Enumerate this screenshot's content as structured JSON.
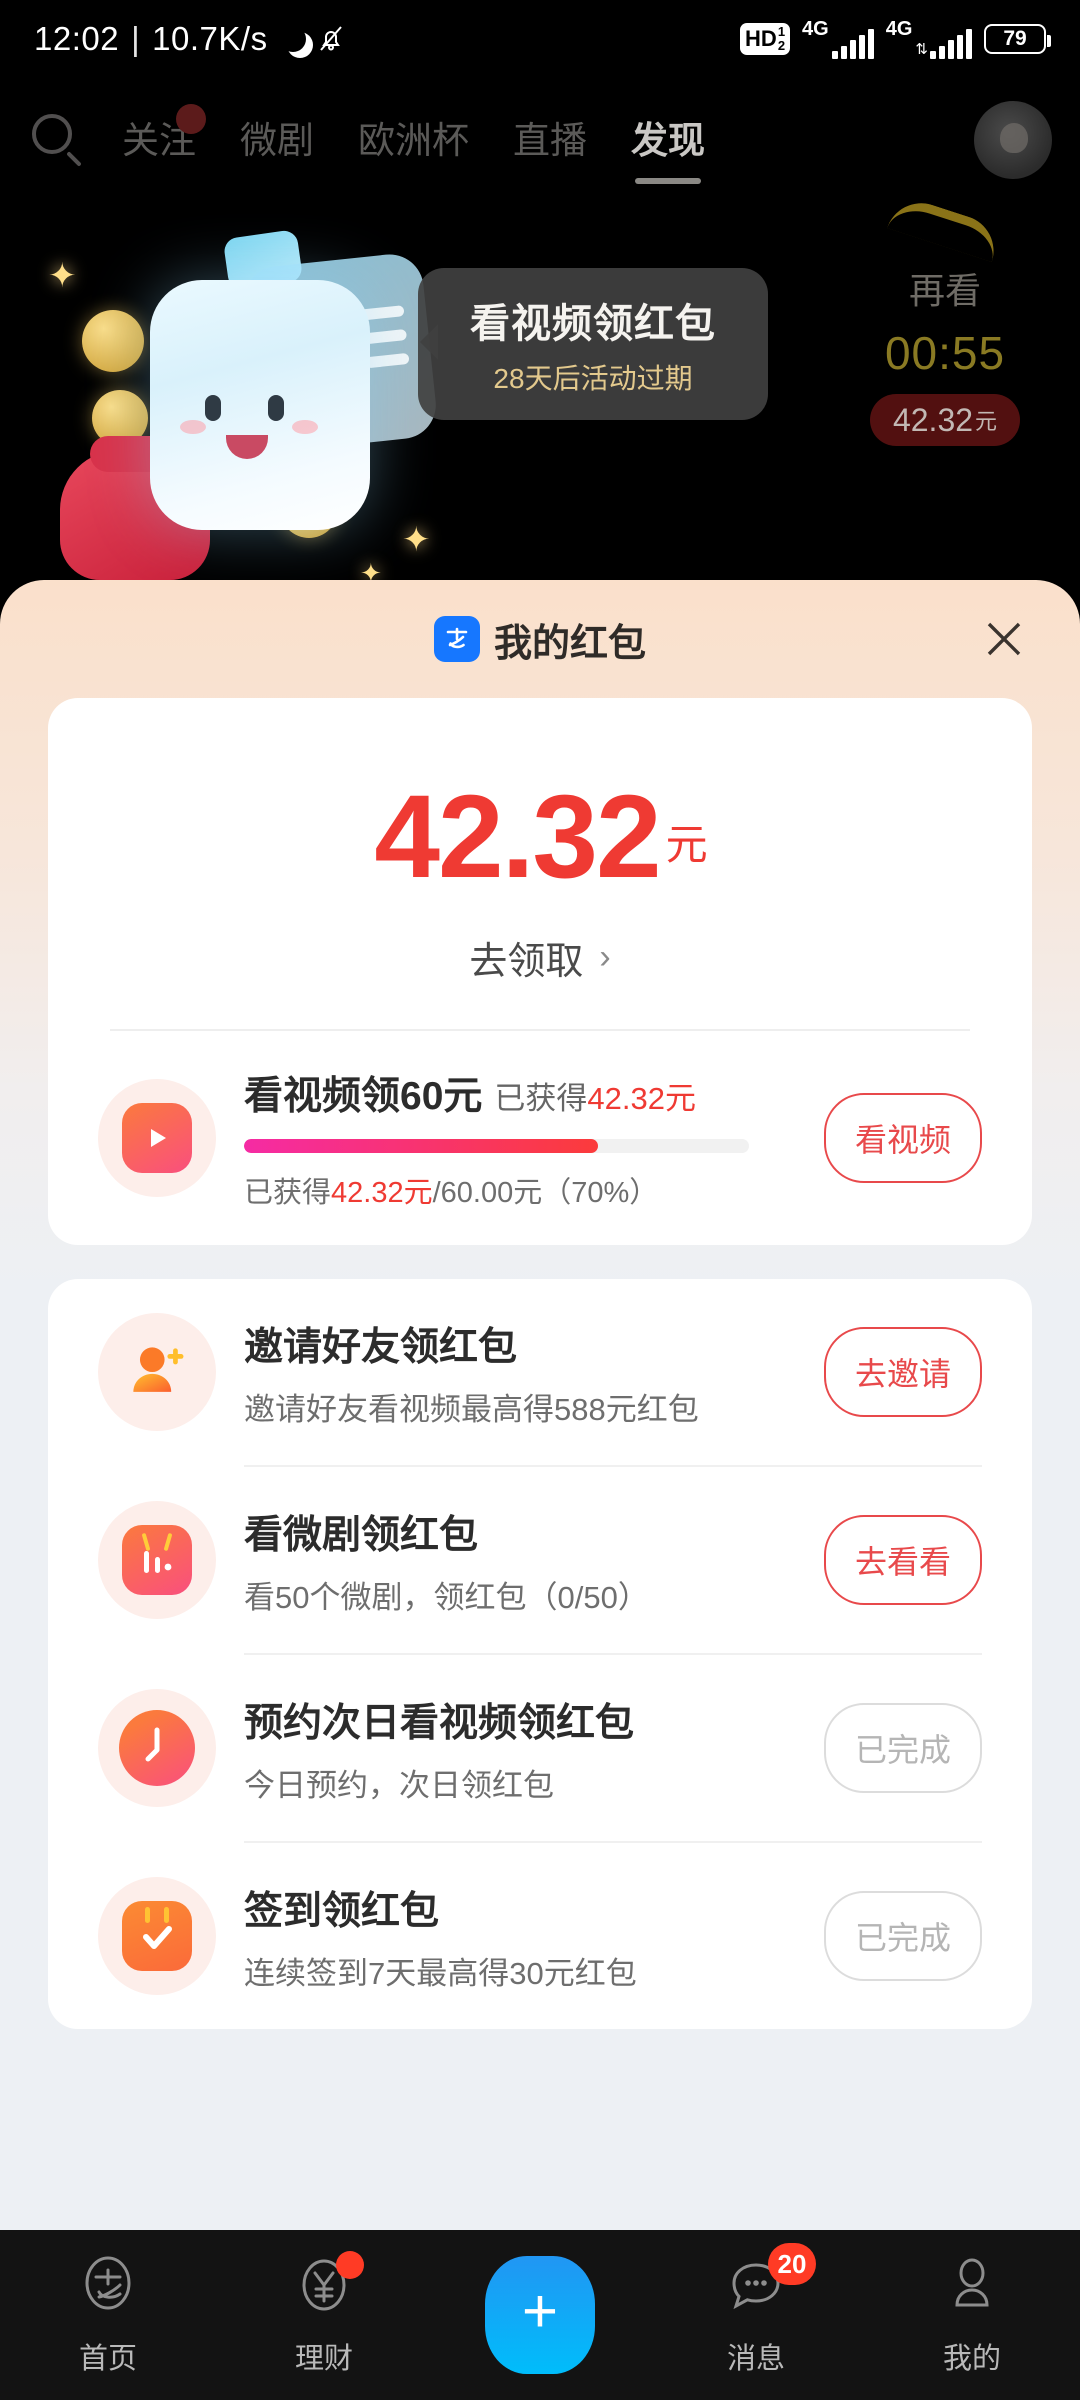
{
  "status_bar": {
    "time": "12:02",
    "separator": "|",
    "network_speed": "10.7K/s",
    "moon_icon": "moon-icon",
    "bell_mute_icon": "bell-mute-icon",
    "hd_label": "HD",
    "hd_sub_top": "1",
    "hd_sub_bottom": "2",
    "sim1_network": "4G",
    "sim2_network": "4G",
    "battery_percent": "79"
  },
  "top_nav": {
    "search_icon": "search-icon",
    "tabs": [
      {
        "label": "关注",
        "active": false,
        "dot": true
      },
      {
        "label": "微剧",
        "active": false,
        "dot": false
      },
      {
        "label": "欧洲杯",
        "active": false,
        "dot": false
      },
      {
        "label": "直播",
        "active": false,
        "dot": false
      },
      {
        "label": "发现",
        "active": true,
        "dot": false
      }
    ],
    "avatar": "avatar"
  },
  "banner": {
    "tooltip_title": "看视频领红包",
    "tooltip_sub": "28天后活动过期",
    "rewatch_label": "再看",
    "countdown": "00:55",
    "reward_amount": "42.32",
    "reward_unit": "元"
  },
  "sheet": {
    "brand_icon": "alipay-logo-icon",
    "title": "我的红包",
    "close_icon": "close-icon",
    "balance": {
      "amount": "42.32",
      "unit": "元",
      "cta": "去领取",
      "chevron": "chevron-right-icon"
    },
    "video_task": {
      "icon": "play-icon",
      "title": "看视频领60元",
      "earned_prefix": "已获得",
      "earned_amount": "42.32",
      "earned_unit": "元",
      "progress_percent": 70,
      "progress_text_prefix": "已获得",
      "progress_earned": "42.32元",
      "progress_sep": "/",
      "progress_total": "60.00元",
      "progress_pct_text": "（70%）",
      "button": "看视频"
    },
    "tasks": [
      {
        "icon": "user-plus-icon",
        "title": "邀请好友领红包",
        "desc": "邀请好友看视频最高得588元红包",
        "button": "去邀请",
        "done": false
      },
      {
        "icon": "tv-icon",
        "title": "看微剧领红包",
        "desc": "看50个微剧，领红包（0/50）",
        "button": "去看看",
        "done": false
      },
      {
        "icon": "clock-icon",
        "title": "预约次日看视频领红包",
        "desc": "今日预约，次日领红包",
        "button": "已完成",
        "done": true
      },
      {
        "icon": "calendar-check-icon",
        "title": "签到领红包",
        "desc": "连续签到7天最高得30元红包",
        "button": "已完成",
        "done": true
      }
    ]
  },
  "bottom_nav": {
    "items": [
      {
        "label": "首页",
        "icon": "alipay-home-icon",
        "badge": null,
        "dot": false
      },
      {
        "label": "理财",
        "icon": "yuan-circle-icon",
        "badge": null,
        "dot": true
      },
      {
        "label": "",
        "icon": "plus-icon",
        "badge": null,
        "dot": false
      },
      {
        "label": "消息",
        "icon": "chat-bubble-icon",
        "badge": "20",
        "dot": false
      },
      {
        "label": "我的",
        "icon": "person-icon",
        "badge": null,
        "dot": false
      }
    ],
    "plus_symbol": "+"
  },
  "colors": {
    "accent_red": "#EF3A33",
    "button_red": "#E8494B",
    "progress_start": "#F52BA4",
    "progress_end": "#FB3B3B",
    "alipay_blue": "#1677FF",
    "sheet_top": "#FAE0CB",
    "sheet_bottom": "#EDF0F4",
    "badge_red": "#FF3B25"
  }
}
